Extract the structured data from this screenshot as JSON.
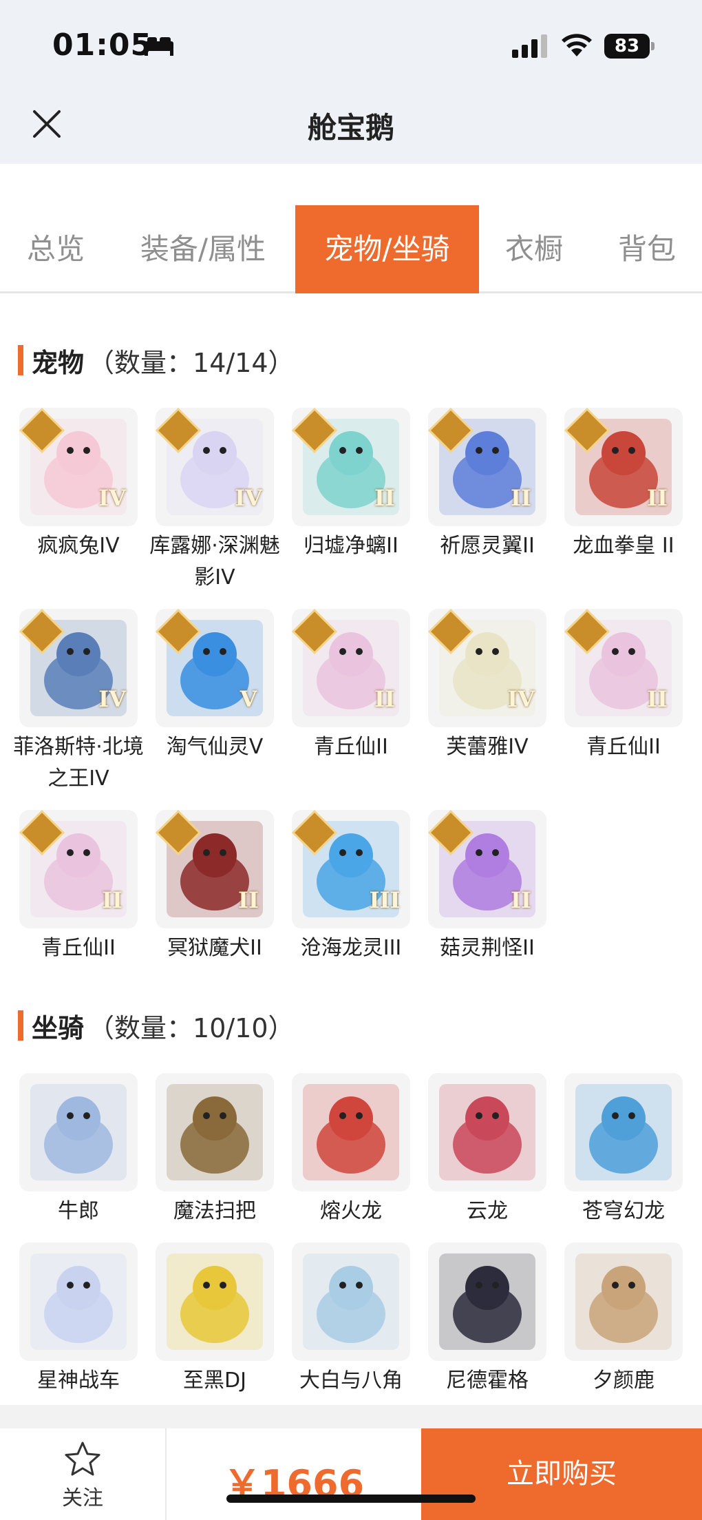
{
  "status_bar": {
    "time": "01:05",
    "battery": "83"
  },
  "header": {
    "title": "舱宝鹅",
    "close_icon": "close-icon"
  },
  "tabs": [
    {
      "label": "总览",
      "active": false
    },
    {
      "label": "装备/属性",
      "active": false
    },
    {
      "label": "宠物/坐骑",
      "active": true
    },
    {
      "label": "衣橱",
      "active": false
    },
    {
      "label": "背包",
      "active": false
    }
  ],
  "pets": {
    "title": "宠物",
    "count": "（数量：14/14）",
    "items": [
      {
        "name": "疯疯兔IV",
        "rank": "IV",
        "icon": "pink-rabbit-pet-icon",
        "color": "#f6c9d6"
      },
      {
        "name": "库露娜·深渊魅影IV",
        "rank": "IV",
        "icon": "white-haired-spirit-pet-icon",
        "color": "#d9d4f2"
      },
      {
        "name": "归墟净螭II",
        "rank": "II",
        "icon": "teal-dragon-pet-icon",
        "color": "#7fd3cf"
      },
      {
        "name": "祈愿灵翼II",
        "rank": "II",
        "icon": "blue-eagle-pet-icon",
        "color": "#5e7fd9"
      },
      {
        "name": "龙血拳皇 II",
        "rank": "II",
        "icon": "red-horned-beast-pet-icon",
        "color": "#c9463a"
      },
      {
        "name": "菲洛斯特·北境之王IV",
        "rank": "IV",
        "icon": "frost-king-pet-icon",
        "color": "#5a7fb8"
      },
      {
        "name": "淘气仙灵V",
        "rank": "V",
        "icon": "blue-puppy-pet-icon",
        "color": "#3a8fe0"
      },
      {
        "name": "青丘仙II",
        "rank": "II",
        "icon": "fox-fairy-pet-icon",
        "color": "#eac3de"
      },
      {
        "name": "芙蕾雅IV",
        "rank": "IV",
        "icon": "valkyrie-pet-icon",
        "color": "#e9e4c6"
      },
      {
        "name": "青丘仙II",
        "rank": "II",
        "icon": "fox-fairy-pet-icon",
        "color": "#eac3de"
      },
      {
        "name": "青丘仙II",
        "rank": "II",
        "icon": "fox-fairy-pet-icon",
        "color": "#eac3de"
      },
      {
        "name": "冥狱魔犬II",
        "rank": "II",
        "icon": "dark-hound-pet-icon",
        "color": "#8c2a2a"
      },
      {
        "name": "沧海龙灵III",
        "rank": "III",
        "icon": "sea-dragon-spirit-pet-icon",
        "color": "#4aa6e6"
      },
      {
        "name": "菇灵荆怪II",
        "rank": "II",
        "icon": "mushroom-sprite-pet-icon",
        "color": "#b07de0"
      }
    ]
  },
  "mounts": {
    "title": "坐骑",
    "count": "（数量：10/10）",
    "items": [
      {
        "name": "牛郎",
        "icon": "ox-mount-icon",
        "color": "#9fb8e0"
      },
      {
        "name": "魔法扫把",
        "icon": "magic-broom-mount-icon",
        "color": "#8a6a3a"
      },
      {
        "name": "熔火龙",
        "icon": "lava-dragon-mount-icon",
        "color": "#d0463c"
      },
      {
        "name": "云龙",
        "icon": "cloud-dragon-mount-icon",
        "color": "#c9485a"
      },
      {
        "name": "苍穹幻龙",
        "icon": "sky-dragon-mount-icon",
        "color": "#4f9fd9"
      },
      {
        "name": "星神战车",
        "icon": "star-chariot-mount-icon",
        "color": "#c9d3f0"
      },
      {
        "name": "至黑DJ",
        "icon": "helmet-dj-mount-icon",
        "color": "#e8c83a"
      },
      {
        "name": "大白与八角",
        "icon": "whale-mount-icon",
        "color": "#a9cde4"
      },
      {
        "name": "尼德霍格",
        "icon": "black-dragon-mount-icon",
        "color": "#2c2c3c"
      },
      {
        "name": "夕颜鹿",
        "icon": "deer-mount-icon",
        "color": "#c9a37a"
      }
    ]
  },
  "bottom_bar": {
    "follow_label": "关注",
    "price": "￥1666",
    "buy_label": "立即购买"
  },
  "colors": {
    "accent": "#ef6a2d",
    "rank_gold": "#c98d2a"
  }
}
